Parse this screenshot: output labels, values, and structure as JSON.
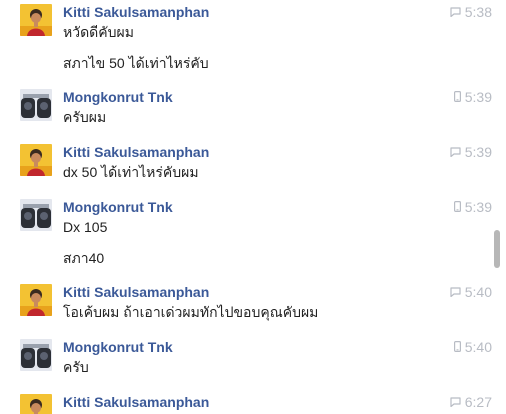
{
  "thread": {
    "groups": [
      {
        "sender": "Kitti Sakulsamanphan",
        "avatar": "kitti",
        "time": "5:38",
        "device_icon": "chat-bubble-icon",
        "lines": [
          "หวัดดีคับผม",
          "สภาไข 50 ได้เท่าไหร่คับ"
        ]
      },
      {
        "sender": "Mongkonrut Tnk",
        "avatar": "mongkonrut",
        "time": "5:39",
        "device_icon": "mobile-icon",
        "lines": [
          "ครับผม"
        ]
      },
      {
        "sender": "Kitti Sakulsamanphan",
        "avatar": "kitti",
        "time": "5:39",
        "device_icon": "chat-bubble-icon",
        "lines": [
          "dx 50 ได้เท่าไหร่คับผม"
        ]
      },
      {
        "sender": "Mongkonrut Tnk",
        "avatar": "mongkonrut",
        "time": "5:39",
        "device_icon": "mobile-icon",
        "lines": [
          "Dx 105",
          "สภา40"
        ]
      },
      {
        "sender": "Kitti Sakulsamanphan",
        "avatar": "kitti",
        "time": "5:40",
        "device_icon": "chat-bubble-icon",
        "lines": [
          "โอเค้บผม ถ้าเอาเด่วผมทักไปขอบคุณคับผม"
        ]
      },
      {
        "sender": "Mongkonrut Tnk",
        "avatar": "mongkonrut",
        "time": "5:40",
        "device_icon": "mobile-icon",
        "lines": [
          "ครับ"
        ]
      },
      {
        "sender": "Kitti Sakulsamanphan",
        "avatar": "kitti",
        "time": "6:27",
        "device_icon": "chat-bubble-icon",
        "lines": []
      }
    ]
  },
  "colors": {
    "sender_name": "#3b5998",
    "message_text": "#222222",
    "timestamp": "#b8bcc4",
    "scrollbar_thumb": "#b7b7b7"
  }
}
